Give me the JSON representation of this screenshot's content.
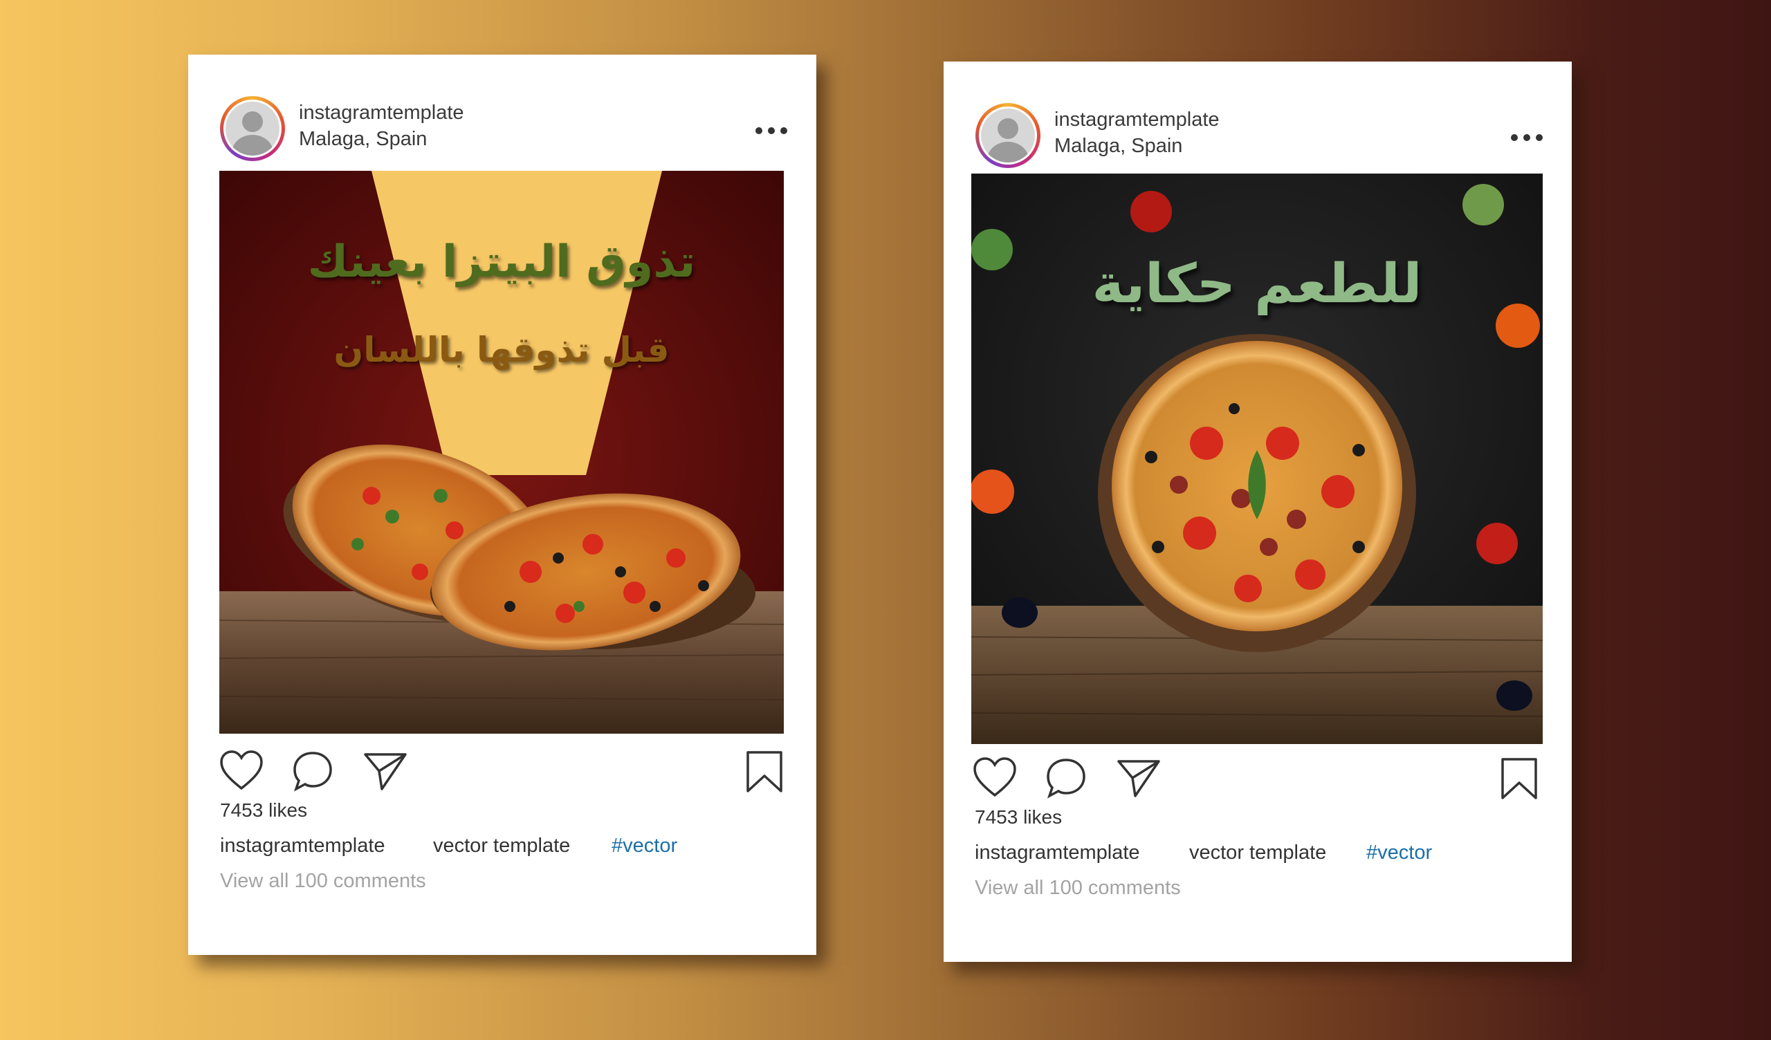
{
  "posts": [
    {
      "username": "instagramtemplate",
      "location": "Malaga, Spain",
      "headline_1": "تذوق البيتزا بعينك",
      "headline_2": "قبل تذوقها باللسان",
      "likes": "7453 likes",
      "caption_user": "instagramtemplate",
      "caption_text": "vector template",
      "caption_tag": "#vector",
      "comments": "View all 100 comments"
    },
    {
      "username": "instagramtemplate",
      "location": "Malaga, Spain",
      "headline_1": "للطعم حكاية",
      "likes": "7453 likes",
      "caption_user": "instagramtemplate",
      "caption_text": "vector template",
      "caption_tag": "#vector",
      "comments": "View all 100 comments"
    }
  ],
  "icons": [
    "avatar-icon",
    "more-options-icon",
    "heart-icon",
    "comment-icon",
    "share-icon",
    "bookmark-icon"
  ],
  "colors": {
    "hashtag": "#1b6fa8",
    "text": "#333333",
    "muted": "#a3a3a3"
  }
}
